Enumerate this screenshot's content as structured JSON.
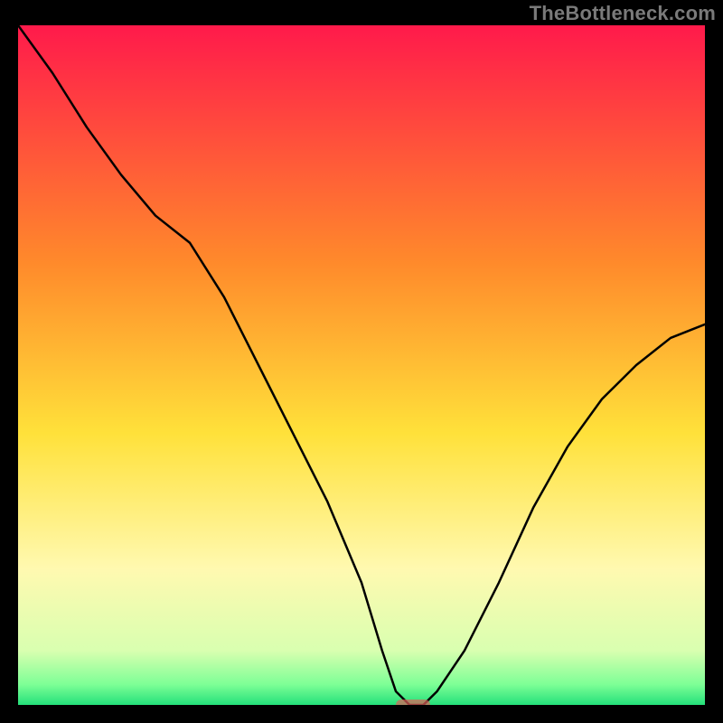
{
  "watermark": "TheBottleneck.com",
  "chart_data": {
    "type": "line",
    "title": "",
    "xlabel": "",
    "ylabel": "",
    "xlim": [
      0,
      100
    ],
    "ylim": [
      0,
      100
    ],
    "grid": false,
    "legend": false,
    "gradient_stops": [
      {
        "offset": 0,
        "color": "#ff1a4b"
      },
      {
        "offset": 35,
        "color": "#ff8a2b"
      },
      {
        "offset": 60,
        "color": "#ffe13a"
      },
      {
        "offset": 80,
        "color": "#fff9b0"
      },
      {
        "offset": 92,
        "color": "#d9ffb0"
      },
      {
        "offset": 97,
        "color": "#7dff96"
      },
      {
        "offset": 100,
        "color": "#24e07a"
      }
    ],
    "series": [
      {
        "name": "bottleneck-curve",
        "x": [
          0,
          5,
          10,
          15,
          20,
          25,
          30,
          35,
          40,
          45,
          50,
          53,
          55,
          57,
          59,
          61,
          65,
          70,
          75,
          80,
          85,
          90,
          95,
          100
        ],
        "y": [
          100,
          93,
          85,
          78,
          72,
          68,
          60,
          50,
          40,
          30,
          18,
          8,
          2,
          0,
          0,
          2,
          8,
          18,
          29,
          38,
          45,
          50,
          54,
          56
        ]
      }
    ],
    "marker": {
      "x_start": 55,
      "x_end": 60,
      "y": 0
    }
  }
}
